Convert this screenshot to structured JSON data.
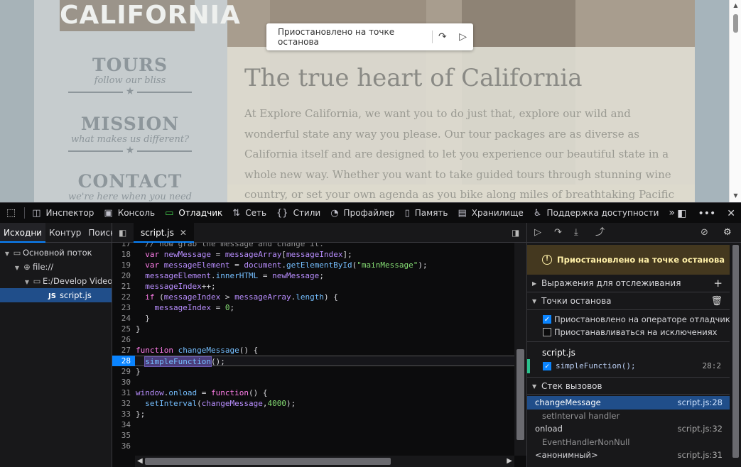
{
  "page": {
    "logo_text": "CALIFORNIA",
    "nav": [
      {
        "title": "TOURS",
        "subtitle": "follow our bliss"
      },
      {
        "title": "MISSION",
        "subtitle": "what makes us different?"
      },
      {
        "title": "CONTACT",
        "subtitle": "we're here when you need us"
      }
    ],
    "heading": "The true heart of California",
    "body": "At Explore California, we want you to do just that, explore our wild and wonderful state any way you please. Our tour packages are as diverse as California itself and are designed to let you experience our beautiful state in a whole new way. Whether you want to take guided tours through stunning wine country, or set your own agenda as you bike along miles of breathtaking Pacific coastline, we have something for",
    "pause_overlay": {
      "text": "Приостановлено на точке останова",
      "step_icon": "step-over-icon",
      "resume_icon": "resume-icon"
    }
  },
  "toolbar": {
    "tools": [
      {
        "label": "Инспектор",
        "icon": "inspector-icon"
      },
      {
        "label": "Консоль",
        "icon": "console-icon"
      },
      {
        "label": "Отладчик",
        "icon": "debugger-icon"
      },
      {
        "label": "Сеть",
        "icon": "network-icon"
      },
      {
        "label": "Стили",
        "icon": "style-editor-icon"
      },
      {
        "label": "Профайлер",
        "icon": "profiler-icon"
      },
      {
        "label": "Память",
        "icon": "memory-icon"
      },
      {
        "label": "Хранилище",
        "icon": "storage-icon"
      },
      {
        "label": "Поддержка доступности",
        "icon": "accessibility-icon"
      }
    ],
    "active_tool": "Отладчик",
    "colors": {
      "active_icon": "#45d04d",
      "accent": "#0a84ff"
    }
  },
  "sources": {
    "tabs": [
      "Исходни",
      "Контур",
      "Поиск"
    ],
    "tree": [
      {
        "label": "Основной поток",
        "level": 0
      },
      {
        "label": "file://",
        "level": 1
      },
      {
        "label": "E:/Develop Video",
        "level": 2
      },
      {
        "label": "script.js",
        "level": 3,
        "selected": true,
        "badge": "JS"
      }
    ]
  },
  "editor": {
    "file_tab": "script.js",
    "line_numbers": [
      "17",
      "18",
      "19",
      "20",
      "21",
      "22",
      "23",
      "24",
      "25",
      "26",
      "27",
      "28",
      "29",
      "30",
      "31",
      "32",
      "33",
      "34",
      "35",
      "36"
    ],
    "paused_line": "28"
  },
  "debugger": {
    "paused_message": "Приостановлено на точке останова",
    "watch_header": "Выражения для отслеживания",
    "breakpoints_header": "Точки останова",
    "pause_on_debugger": "Приостановлено на операторе отладчика",
    "pause_on_exceptions": "Приостанавливаться на исключениях",
    "bp_file": "script.js",
    "bp_code": "simpleFunction();",
    "bp_location": "28:2",
    "callstack_header": "Стек вызовов",
    "frames": [
      {
        "name": "changeMessage",
        "loc": "script.js:28",
        "selected": true
      },
      {
        "name": "setInterval handler",
        "loc": "",
        "group": true
      },
      {
        "name": "onload",
        "loc": "script.js:32"
      },
      {
        "name": "EventHandlerNonNull",
        "loc": "",
        "group": true
      },
      {
        "name": "<анонимный>",
        "loc": "script.js:31"
      }
    ]
  }
}
